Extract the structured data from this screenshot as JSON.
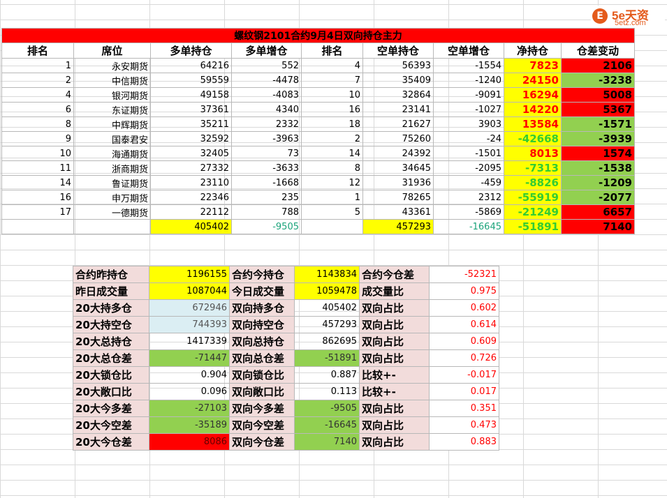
{
  "logo": {
    "mark": "E",
    "brand": "5e天资",
    "site": "5etz.com"
  },
  "title": "螺纹钢2101合约9月4日双向持仓主力",
  "headers": [
    "排名",
    "席位",
    "多单持仓",
    "多单增仓",
    "排名",
    "空单持仓",
    "空单增仓",
    "净持仓",
    "仓差变动"
  ],
  "rows": [
    {
      "rank": "1",
      "seat": "永安期货",
      "long": "64216",
      "long_chg": "552",
      "srank": "4",
      "short": "56393",
      "short_chg": "-1554",
      "net": "7823",
      "diff": "2106"
    },
    {
      "rank": "2",
      "seat": "中信期货",
      "long": "59559",
      "long_chg": "-4478",
      "srank": "7",
      "short": "35409",
      "short_chg": "-1240",
      "net": "24150",
      "diff": "-3238"
    },
    {
      "rank": "4",
      "seat": "银河期货",
      "long": "49158",
      "long_chg": "-4083",
      "srank": "10",
      "short": "32864",
      "short_chg": "-9091",
      "net": "16294",
      "diff": "5008"
    },
    {
      "rank": "6",
      "seat": "东证期货",
      "long": "37361",
      "long_chg": "4340",
      "srank": "16",
      "short": "23141",
      "short_chg": "-1027",
      "net": "14220",
      "diff": "5367"
    },
    {
      "rank": "8",
      "seat": "中辉期货",
      "long": "35211",
      "long_chg": "2332",
      "srank": "18",
      "short": "21627",
      "short_chg": "3903",
      "net": "13584",
      "diff": "-1571"
    },
    {
      "rank": "9",
      "seat": "国泰君安",
      "long": "32592",
      "long_chg": "-3963",
      "srank": "2",
      "short": "75260",
      "short_chg": "-24",
      "net": "-42668",
      "diff": "-3939"
    },
    {
      "rank": "10",
      "seat": "海通期货",
      "long": "32405",
      "long_chg": "73",
      "srank": "14",
      "short": "24392",
      "short_chg": "-1501",
      "net": "8013",
      "diff": "1574"
    },
    {
      "rank": "11",
      "seat": "浙商期货",
      "long": "27332",
      "long_chg": "-3633",
      "srank": "8",
      "short": "34645",
      "short_chg": "-2095",
      "net": "-7313",
      "diff": "-1538"
    },
    {
      "rank": "14",
      "seat": "鲁证期货",
      "long": "23110",
      "long_chg": "-1668",
      "srank": "12",
      "short": "31936",
      "short_chg": "-459",
      "net": "-8826",
      "diff": "-1209"
    },
    {
      "rank": "16",
      "seat": "申万期货",
      "long": "22346",
      "long_chg": "235",
      "srank": "1",
      "short": "78265",
      "short_chg": "2312",
      "net": "-55919",
      "diff": "-2077"
    },
    {
      "rank": "17",
      "seat": "一德期货",
      "long": "22112",
      "long_chg": "788",
      "srank": "5",
      "short": "43361",
      "short_chg": "-5869",
      "net": "-21249",
      "diff": "6657"
    }
  ],
  "totals": {
    "long": "405402",
    "long_chg": "-9505",
    "short": "457293",
    "short_chg": "-16645",
    "net": "-51891",
    "diff": "7140"
  },
  "summary": [
    {
      "l1": "合约昨持仓",
      "v1": "1196155",
      "l2": "合约今持仓",
      "v2": "1143834",
      "l3": "合约今仓差",
      "v3": "-52321"
    },
    {
      "l1": "昨日成交量",
      "v1": "1087044",
      "l2": "今日成交量",
      "v2": "1059478",
      "l3": "成交量比",
      "v3": "0.975"
    },
    {
      "l1": "20大持多仓",
      "v1": "672946",
      "l2": "双向持多仓",
      "v2": "405402",
      "l3": "双向占比",
      "v3": "0.602"
    },
    {
      "l1": "20大持空仓",
      "v1": "744393",
      "l2": "双向持空仓",
      "v2": "457293",
      "l3": "双向占比",
      "v3": "0.614"
    },
    {
      "l1": "20大总持仓",
      "v1": "1417339",
      "l2": "双向总持仓",
      "v2": "862695",
      "l3": "双向占比",
      "v3": "0.609"
    },
    {
      "l1": "20大总仓差",
      "v1": "-71447",
      "l2": "双向总仓差",
      "v2": "-51891",
      "l3": "双向占比",
      "v3": "0.726"
    },
    {
      "l1": "20大锁仓比",
      "v1": "0.904",
      "l2": "双向锁仓比",
      "v2": "0.887",
      "l3": "比较+-",
      "v3": "-0.017"
    },
    {
      "l1": "20大敞口比",
      "v1": "0.096",
      "l2": "双向敞口比",
      "v2": "0.113",
      "l3": "比较+-",
      "v3": "0.017"
    },
    {
      "l1": "20大今多差",
      "v1": "-27103",
      "l2": "双向今多差",
      "v2": "-9505",
      "l3": "双向占比",
      "v3": "0.351"
    },
    {
      "l1": "20大今空差",
      "v1": "-35189",
      "l2": "双向今空差",
      "v2": "-16645",
      "l3": "双向占比",
      "v3": "0.473"
    },
    {
      "l1": "20大今仓差",
      "v1": "8086",
      "l2": "双向今仓差",
      "v2": "7140",
      "l3": "双向占比",
      "v3": "0.883"
    }
  ],
  "colors": {
    "red": "#ff0000",
    "yellow": "#ffff00",
    "green": "#92d050",
    "pink": "#f2dcdb",
    "lightblue": "#dbeef3"
  }
}
